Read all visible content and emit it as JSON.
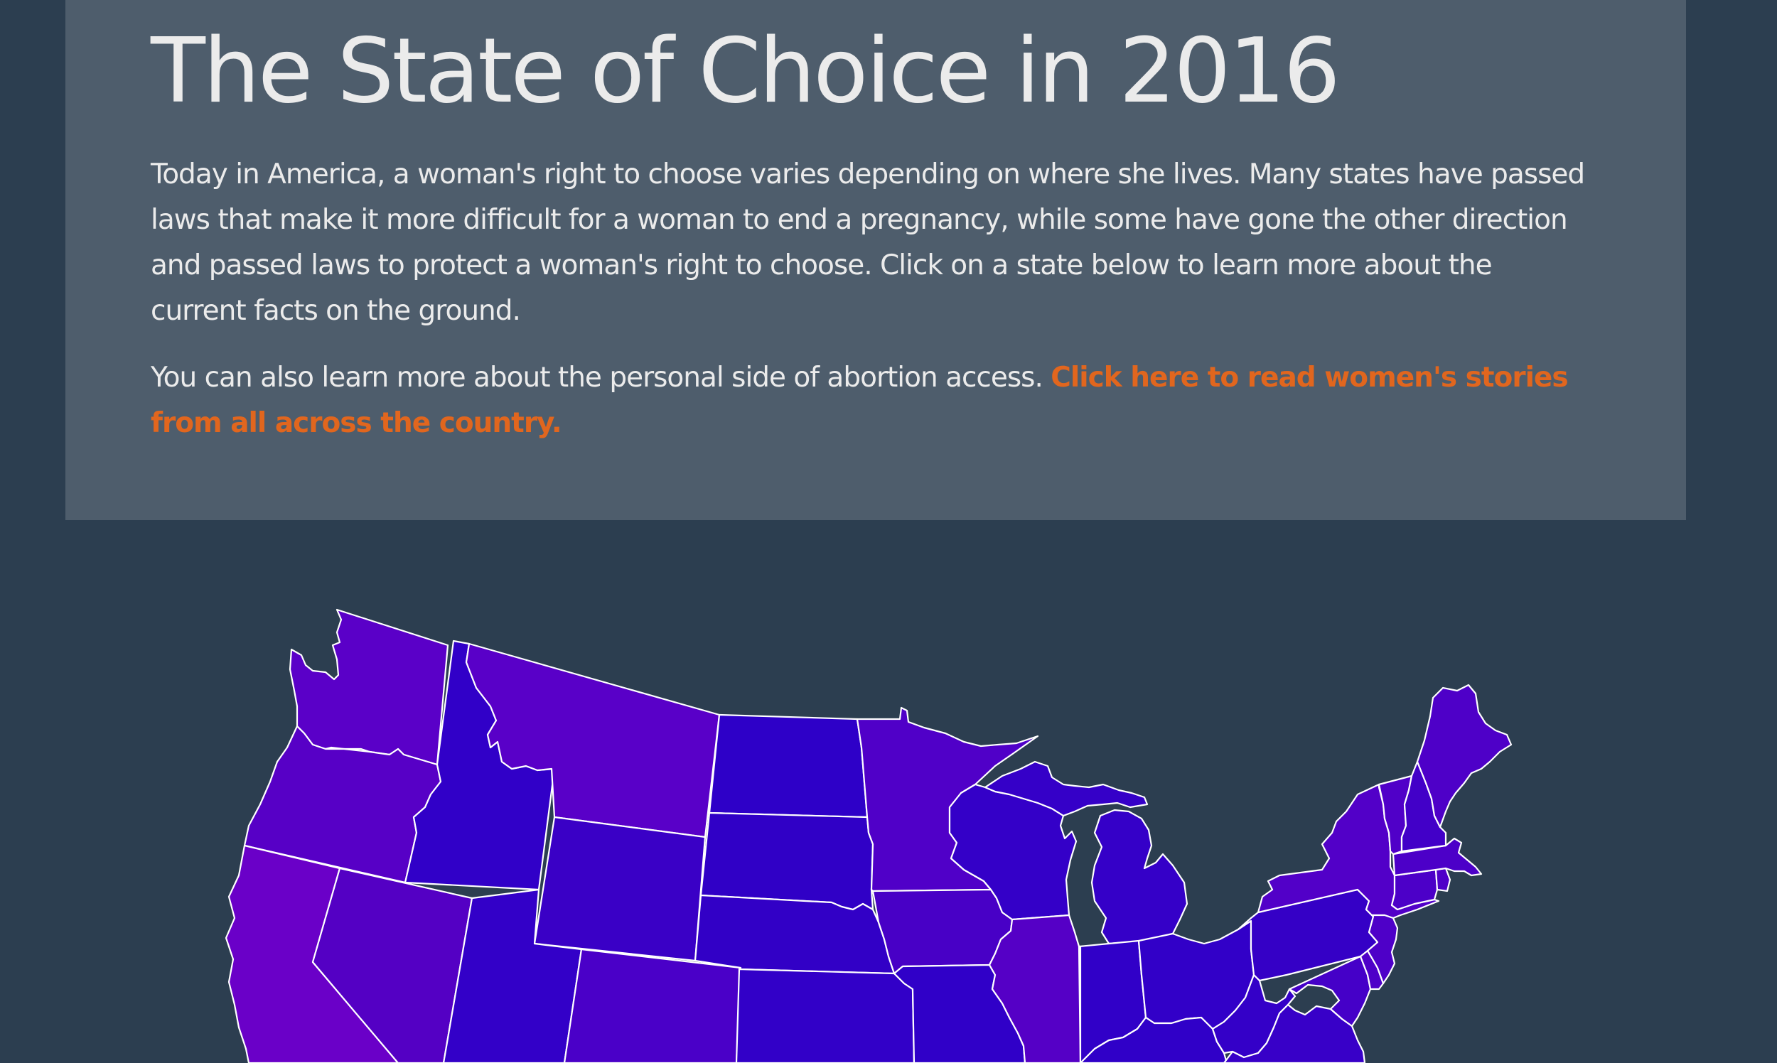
{
  "header": {
    "title": "The State of Choice in 2016",
    "intro": "Today in America, a woman's right to choose varies depending on where she lives. Many states have passed laws that make it more difficult for a woman to end a pregnancy, while some have gone the other direction and passed laws to protect a woman's right to choose. Click on a state below to learn more about the current facts on the ground.",
    "stories_prefix": "You can also learn more about the personal side of abortion access. ",
    "stories_link": "Click here to read women's stories from all across the country."
  },
  "colors": {
    "background": "#2c3e50",
    "panel": "#4e5d6c",
    "text": "#ebebeb",
    "link": "#e1661e",
    "state_border": "#ffffff"
  },
  "map": {
    "states": [
      {
        "id": "WA",
        "color": "#5a00c8"
      },
      {
        "id": "OR",
        "color": "#5700c6"
      },
      {
        "id": "CA",
        "color": "#6a00c8"
      },
      {
        "id": "ID",
        "color": "#3100c8"
      },
      {
        "id": "NV",
        "color": "#5400c4"
      },
      {
        "id": "MT",
        "color": "#5900c8"
      },
      {
        "id": "WY",
        "color": "#3a00c6"
      },
      {
        "id": "UT",
        "color": "#3300c8"
      },
      {
        "id": "CO",
        "color": "#4a00c8"
      },
      {
        "id": "ND",
        "color": "#2e00c8"
      },
      {
        "id": "SD",
        "color": "#3000c6"
      },
      {
        "id": "NE",
        "color": "#3200c6"
      },
      {
        "id": "KS",
        "color": "#3200c8"
      },
      {
        "id": "MN",
        "color": "#5000c8"
      },
      {
        "id": "IA",
        "color": "#4800c6"
      },
      {
        "id": "MO",
        "color": "#3000c8"
      },
      {
        "id": "WI",
        "color": "#3400c8"
      },
      {
        "id": "IL",
        "color": "#5500c6"
      },
      {
        "id": "MI",
        "color": "#3500c8"
      },
      {
        "id": "IN",
        "color": "#3100c8"
      },
      {
        "id": "OH",
        "color": "#3200c8"
      },
      {
        "id": "KY",
        "color": "#3000c8"
      },
      {
        "id": "WV",
        "color": "#3400c8"
      },
      {
        "id": "PA",
        "color": "#3500c6"
      },
      {
        "id": "NY",
        "color": "#5200c8"
      },
      {
        "id": "VA",
        "color": "#3800c8"
      },
      {
        "id": "MD",
        "color": "#4500c8"
      },
      {
        "id": "DE",
        "color": "#4e00c8"
      },
      {
        "id": "NJ",
        "color": "#4e00c8"
      },
      {
        "id": "CT",
        "color": "#4c00c8"
      },
      {
        "id": "RI",
        "color": "#4f00c8"
      },
      {
        "id": "MA",
        "color": "#4c00c8"
      },
      {
        "id": "VT",
        "color": "#5000c8"
      },
      {
        "id": "NH",
        "color": "#4200c8"
      },
      {
        "id": "ME",
        "color": "#4e00c8"
      }
    ]
  }
}
